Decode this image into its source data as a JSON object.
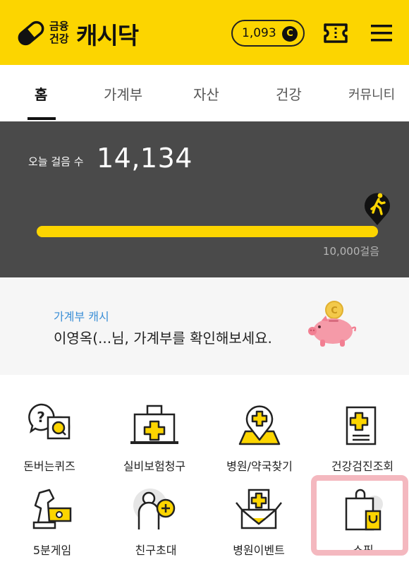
{
  "header": {
    "logo_small_line1": "금융",
    "logo_small_line2": "건강",
    "logo_text": "캐시닥",
    "cash_amount": "1,093",
    "cash_symbol": "C",
    "icons": [
      "pill-logo-icon",
      "coin-icon",
      "ticket-icon",
      "menu-icon"
    ],
    "brand_color": "#fcd500"
  },
  "tabs": [
    {
      "label": "홈",
      "active": true
    },
    {
      "label": "가계부",
      "active": false
    },
    {
      "label": "자산",
      "active": false
    },
    {
      "label": "건강",
      "active": false
    },
    {
      "label": "커뮤니티",
      "active": false
    }
  ],
  "steps": {
    "label": "오늘 걸음 수",
    "value": "14,134",
    "goal": "10,000걸음",
    "progress_fraction": 1.0,
    "icon": "walker-pin-icon"
  },
  "banner": {
    "subtitle": "가계부 캐시",
    "message": "이영옥(...님, 가계부를 확인해보세요.",
    "icon": "piggy-bank-icon",
    "subtitle_color": "#3b8fd6"
  },
  "grid": [
    {
      "label": "돈버는퀴즈",
      "icon": "quiz-icon"
    },
    {
      "label": "실비보험청구",
      "icon": "insurance-claim-icon"
    },
    {
      "label": "병원/약국찾기",
      "icon": "hospital-map-icon"
    },
    {
      "label": "건강검진조회",
      "icon": "checkup-report-icon"
    },
    {
      "label": "5분게임",
      "icon": "chess-knight-icon"
    },
    {
      "label": "친구초대",
      "icon": "invite-friend-icon"
    },
    {
      "label": "병원이벤트",
      "icon": "hospital-event-icon"
    },
    {
      "label": "쇼핑",
      "icon": "shopping-bag-icon"
    }
  ]
}
